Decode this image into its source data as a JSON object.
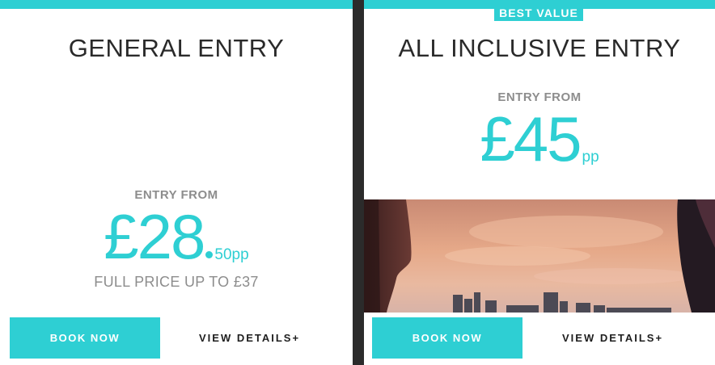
{
  "cards": [
    {
      "title": "GENERAL ENTRY",
      "entry_label": "ENTRY FROM",
      "price_main": "£28",
      "price_suffix": "50pp",
      "full_price": "FULL PRICE UP TO £37",
      "book_label": "BOOK NOW",
      "details_label": "VIEW DETAILS+"
    },
    {
      "badge": "BEST VALUE",
      "title": "ALL INCLUSIVE ENTRY",
      "entry_label": "ENTRY FROM",
      "price_main": "£45",
      "price_suffix": "pp",
      "book_label": "BOOK NOW",
      "details_label": "VIEW DETAILS+"
    }
  ],
  "colors": {
    "accent": "#2ecfd3",
    "text_dark": "#2a2a2a",
    "text_muted": "#8d8d8d",
    "background": "#2b2b2b"
  }
}
